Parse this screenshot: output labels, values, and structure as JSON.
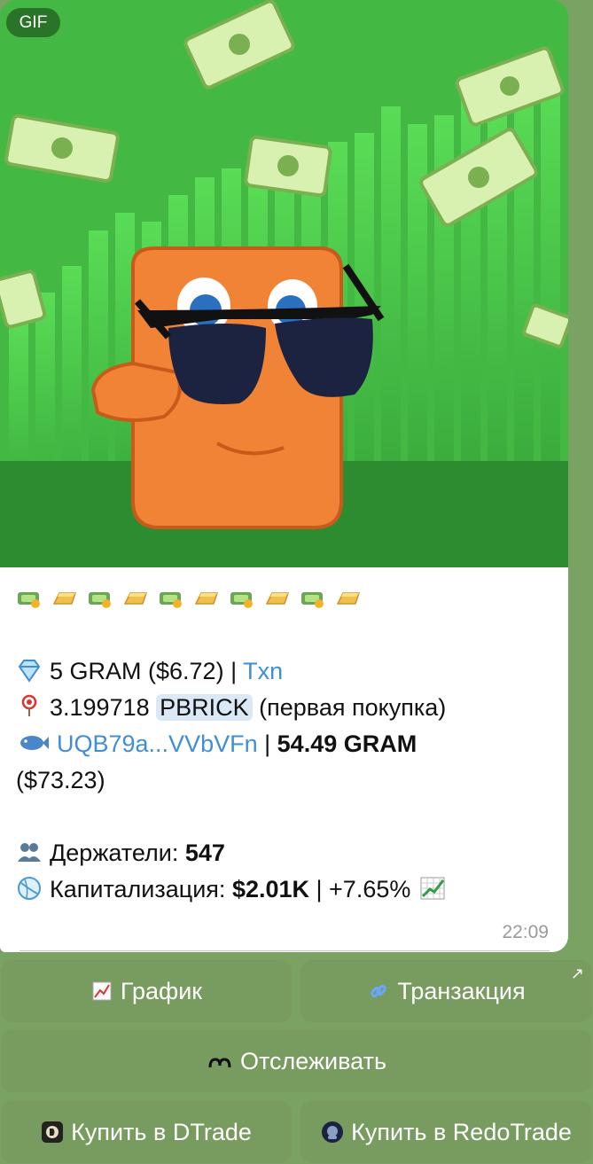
{
  "media": {
    "badge": "GIF"
  },
  "message": {
    "banner_emojis": [
      "money-bag-icon",
      "gold-bar-icon",
      "money-bag-icon",
      "gold-bar-icon",
      "money-bag-icon",
      "gold-bar-icon",
      "money-bag-icon",
      "gold-bar-icon",
      "money-bag-icon",
      "gold-bar-icon"
    ],
    "line1": {
      "amount": "5 GRAM ($6.72) | ",
      "link": "Txn"
    },
    "line2": {
      "amount": "3.199718 ",
      "ticker": "PBRICK",
      "note": " (первая покупка)"
    },
    "line3": {
      "wallet": "UQB79a...VVbVFn",
      "sep": " | ",
      "balance": "54.49 GRAM",
      "balance_usd": "($73.23)"
    },
    "holders": {
      "label": "Держатели: ",
      "value": "547"
    },
    "cap": {
      "label": "Капитализация: ",
      "value": "$2.01K",
      "change": " | +7.65% "
    },
    "time": "22:09"
  },
  "buttons": {
    "chart": "График",
    "txn": "Транзакция",
    "track": "Отслеживать",
    "dtrade": "Купить в DTrade",
    "redotrade": "Купить в RedoTrade"
  }
}
